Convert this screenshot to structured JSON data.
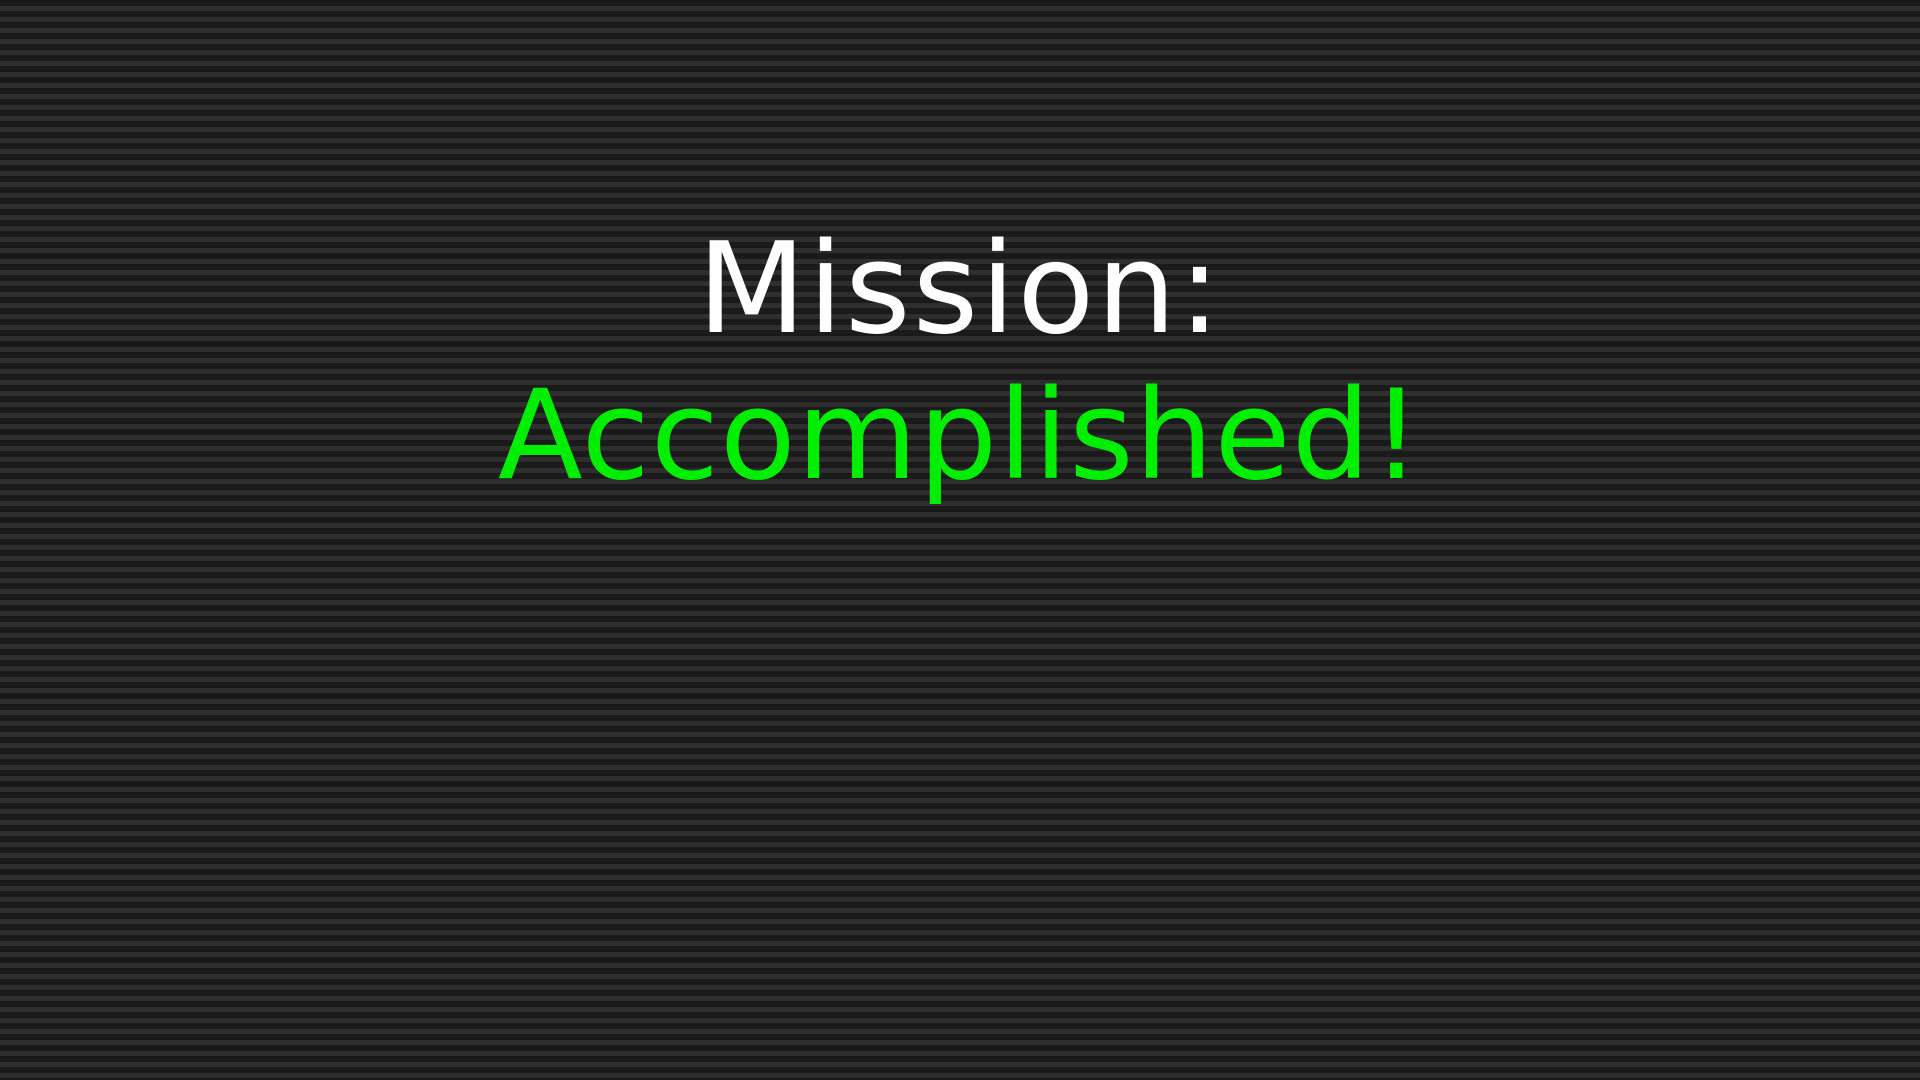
{
  "screen": {
    "line_1": "Mission:",
    "line_2": "Accomplished!"
  },
  "colors": {
    "line_1": "#ffffff",
    "line_2": "#00ee00",
    "background": "#1a1a1a",
    "scanline": "#2e2e2e"
  }
}
